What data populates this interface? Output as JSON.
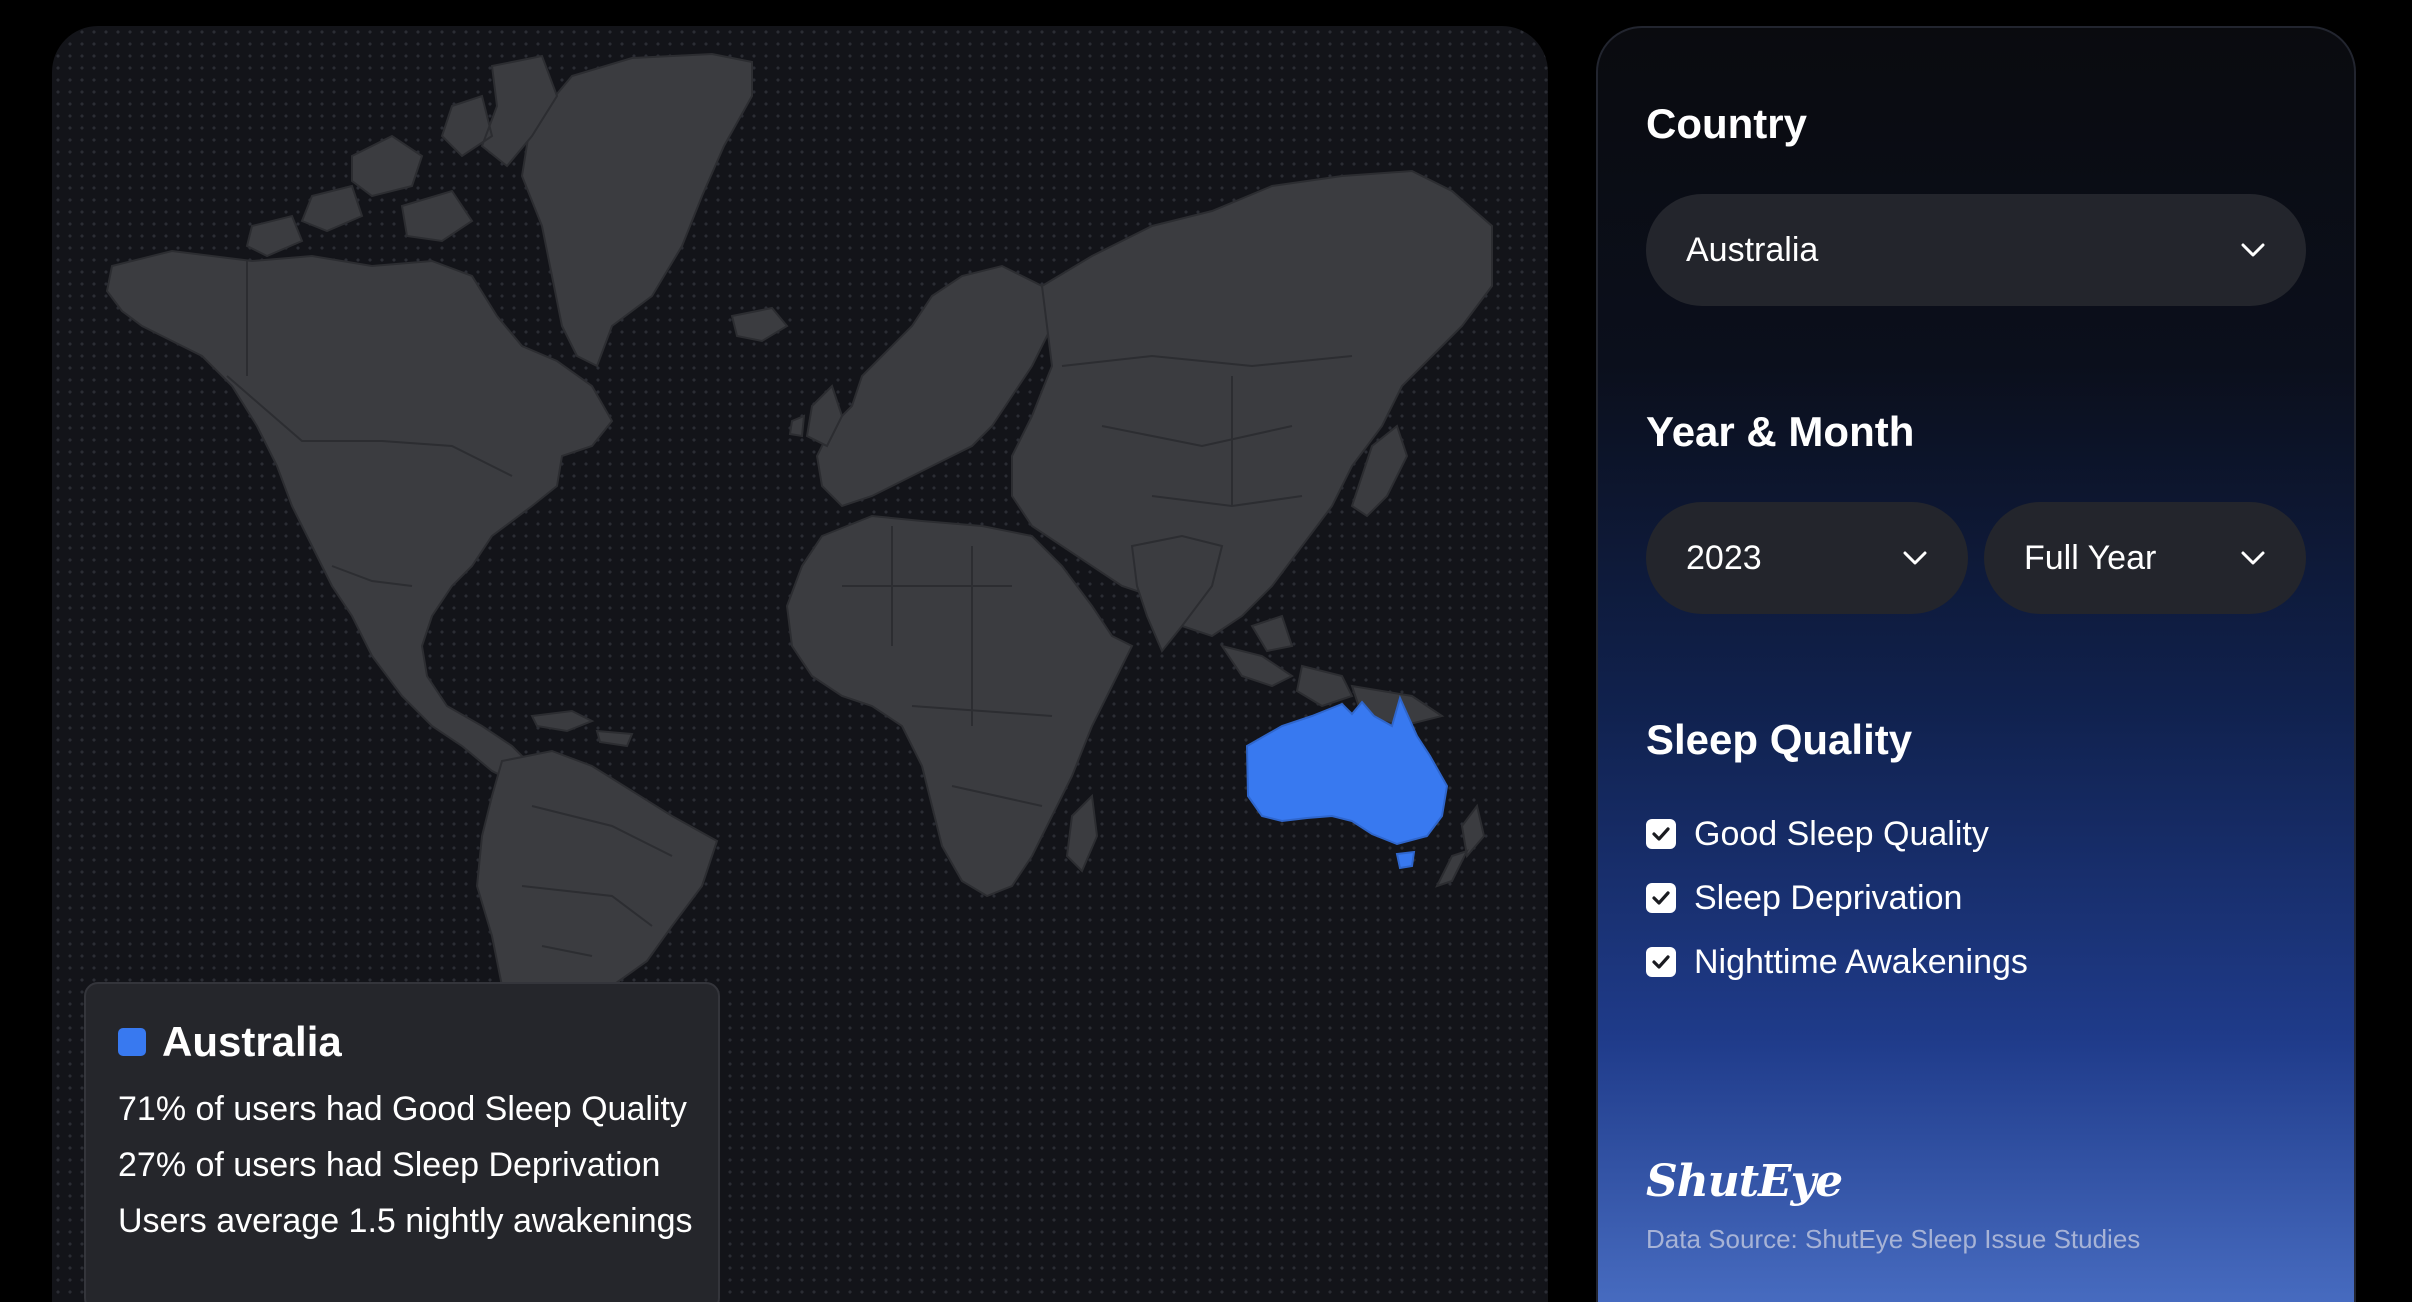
{
  "map": {
    "highlight_color": "#3879f0",
    "land_color": "#3b3c40",
    "selected_country": "Australia"
  },
  "info": {
    "title": "Australia",
    "swatch_color": "#3879f0",
    "lines": [
      "71% of users had Good Sleep Quality",
      "27% of users had Sleep Deprivation",
      "Users average 1.5 nightly awakenings"
    ]
  },
  "controls": {
    "country_label": "Country",
    "country_value": "Australia",
    "period_label": "Year & Month",
    "year_value": "2023",
    "month_value": "Full Year",
    "quality_label": "Sleep Quality",
    "options": [
      {
        "label": "Good Sleep Quality",
        "checked": true
      },
      {
        "label": "Sleep Deprivation",
        "checked": true
      },
      {
        "label": "Nighttime Awakenings",
        "checked": true
      }
    ]
  },
  "footer": {
    "brand": "ShutEye",
    "source": "Data Source: ShutEye Sleep Issue Studies"
  }
}
